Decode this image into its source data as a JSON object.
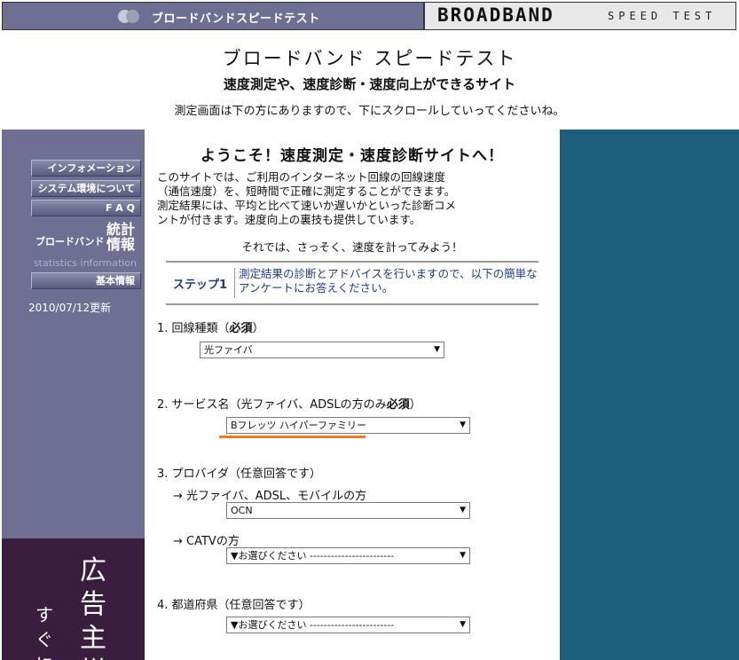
{
  "banner": {
    "left_title": "ブロードバンドスピードテスト",
    "right_strong": "BROADBAND",
    "right_light": "SPEED TEST"
  },
  "header": {
    "title": "ブロードバンド スピードテスト",
    "subtitle": "速度測定や、速度診断・速度向上ができるサイト",
    "note": "測定画面は下の方にありますので、下にスクロールしていってくださいね。"
  },
  "sidebar": {
    "items": [
      {
        "label": "インフォメーション"
      },
      {
        "label": "システム環境について"
      },
      {
        "label": "F A Q"
      },
      {
        "label": "基本情報"
      }
    ],
    "stats_label": "ブロードバンド",
    "stats_title": "統計情報",
    "stats_sub": "statistics information",
    "updated": "2010/07/12更新",
    "ad_col1": "広告主様",
    "ad_col2": "すぐに"
  },
  "main": {
    "welcome": "ようこそ！速度測定・速度診断サイトへ！",
    "intro_lines": [
      "このサイトでは、ご利用のインターネット回線の回線速度",
      "（通信速度）を、短時間で正確に測定することができます。",
      "測定結果には、平均と比べて速いか遅いかといった診断コメ",
      "ントが付きます。速度向上の裏技も提供しています。"
    ],
    "lets_measure": "それでは、さっそく、速度を計ってみよう！",
    "step": {
      "label": "ステップ1",
      "text": "測定結果の診断とアドバイスを行いますので、以下の簡単なアンケートにお答えください。"
    },
    "q1": {
      "prefix": "1. 回線種類（",
      "required": "必須",
      "suffix": "）",
      "value": "光ファイバ"
    },
    "q2": {
      "prefix": "2. サービス名（光ファイバ、ADSLの方のみ",
      "required": "必須",
      "suffix": "）",
      "value": "Bフレッツ ハイパーファミリー"
    },
    "q3": {
      "label": "3. プロバイダ（任意回答です）",
      "sub1_label": "→ 光ファイバ、ADSL、モバイルの方",
      "sub1_value": "OCN",
      "sub2_label": "→ CATVの方",
      "sub2_value": "▼お選びください ------------------------"
    },
    "q4": {
      "label": "4. 都道府県（任意回答です）",
      "value": "▼お選びください ------------------------"
    }
  },
  "colors": {
    "sidebar": "#6e6f93",
    "right_column": "#1b5e7e",
    "ad_background": "#3b1e3d",
    "highlight": "#f07a1c",
    "step_text": "#1b3b8a"
  }
}
